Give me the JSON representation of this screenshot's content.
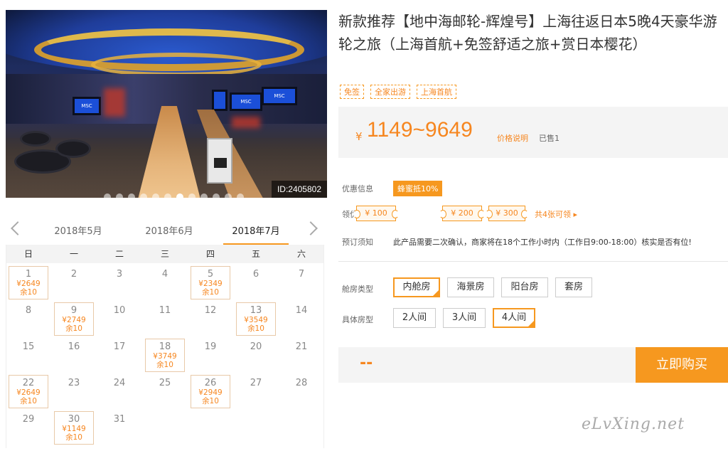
{
  "gallery": {
    "id_label": "ID:2405802",
    "dots": 12,
    "active_dot": 6,
    "screen_text": "MSC"
  },
  "calendar": {
    "tabs": [
      "2018年5月",
      "2018年6月",
      "2018年7月"
    ],
    "active_tab": 2,
    "weekdays": [
      "日",
      "一",
      "二",
      "三",
      "四",
      "五",
      "六"
    ],
    "days": [
      {
        "d": "1",
        "price": "¥2649",
        "stock": "余10"
      },
      {
        "d": "2"
      },
      {
        "d": "3"
      },
      {
        "d": "4"
      },
      {
        "d": "5",
        "price": "¥2349",
        "stock": "余10"
      },
      {
        "d": "6"
      },
      {
        "d": "7"
      },
      {
        "d": "8"
      },
      {
        "d": "9",
        "price": "¥2749",
        "stock": "余10"
      },
      {
        "d": "10"
      },
      {
        "d": "11"
      },
      {
        "d": "12"
      },
      {
        "d": "13",
        "price": "¥3549",
        "stock": "余10"
      },
      {
        "d": "14"
      },
      {
        "d": "15"
      },
      {
        "d": "16"
      },
      {
        "d": "17"
      },
      {
        "d": "18",
        "price": "¥3749",
        "stock": "余10"
      },
      {
        "d": "19"
      },
      {
        "d": "20"
      },
      {
        "d": "21"
      },
      {
        "d": "22",
        "price": "¥2649",
        "stock": "余10"
      },
      {
        "d": "23"
      },
      {
        "d": "24"
      },
      {
        "d": "25"
      },
      {
        "d": "26",
        "price": "¥2949",
        "stock": "余10"
      },
      {
        "d": "27"
      },
      {
        "d": "28"
      },
      {
        "d": "29"
      },
      {
        "d": "30",
        "price": "¥1149",
        "stock": "余10"
      },
      {
        "d": "31"
      }
    ]
  },
  "product": {
    "title": "新款推荐【地中海邮轮-辉煌号】上海往返日本5晚4天豪华游轮之旅（上海首航+免签舒适之旅+赏日本樱花）",
    "tags": [
      "免签",
      "全家出游",
      "上海首航"
    ],
    "currency": "¥",
    "price": "1149~9649",
    "price_note": "价格说明",
    "sold": "已售1"
  },
  "info": {
    "promo_label": "优惠信息",
    "promo_badge": "蜂蜜抵10%",
    "coupon_label": "领优惠券",
    "coupons": [
      "¥ 100",
      "¥ 200",
      "¥ 300"
    ],
    "coupon_more": "共4张可领 ▸",
    "notice_label": "预订须知",
    "notice_text": "此产品需要二次确认，商家将在18个工作小时内（工作日9:00-18:00）核实是否有位!"
  },
  "options": {
    "cabin_label": "舱房类型",
    "cabins": [
      "内舱房",
      "海景房",
      "阳台房",
      "套房"
    ],
    "cabin_selected": 0,
    "room_label": "具体房型",
    "rooms": [
      "2人间",
      "3人间",
      "4人间"
    ],
    "room_selected": 2
  },
  "buy": {
    "total": "--",
    "button": "立即购买"
  },
  "watermark": "eLvXing.net",
  "colors": {
    "accent": "#f6981f"
  }
}
